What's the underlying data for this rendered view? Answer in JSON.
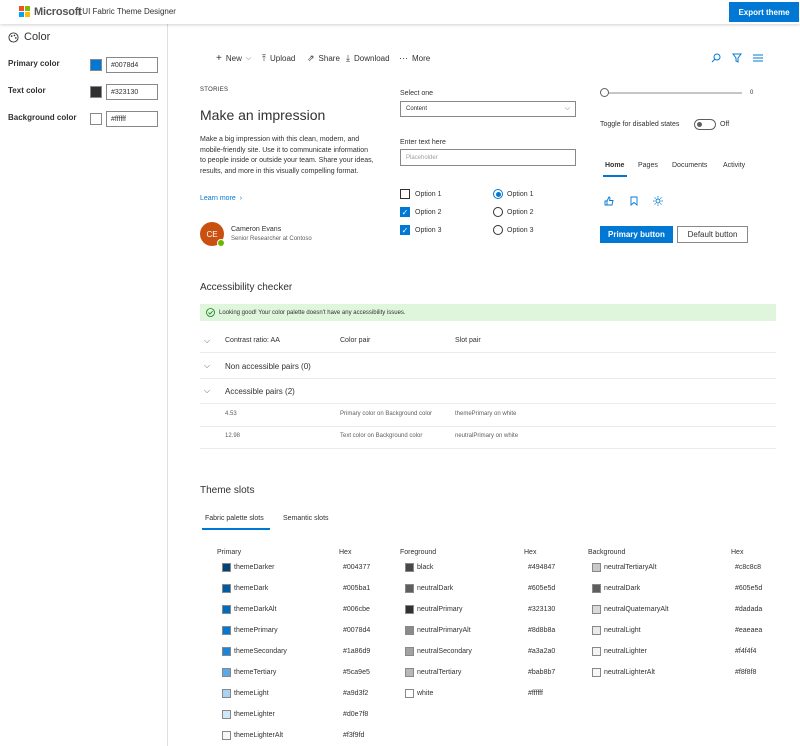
{
  "header": {
    "brand": "Microsoft",
    "app_title": "| UI Fabric Theme Designer",
    "export_label": "Export theme"
  },
  "sidebar": {
    "title": "Color",
    "rows": [
      {
        "label": "Primary color",
        "hex": "#0078d4",
        "swatch": "#0078d4"
      },
      {
        "label": "Text color",
        "hex": "#323130",
        "swatch": "#323130"
      },
      {
        "label": "Background color",
        "hex": "#ffffff",
        "swatch": "#ffffff"
      }
    ]
  },
  "commandbar": {
    "new": "New",
    "upload": "Upload",
    "share": "Share",
    "download": "Download",
    "more": "More"
  },
  "story": {
    "eyebrow": "STORIES",
    "title": "Make an impression",
    "body": "Make a big impression with this clean, modern, and mobile-friendly site. Use it to communicate information to people inside or outside your team. Share your ideas, results, and more in this visually compelling format.",
    "link": "Learn more",
    "persona_initials": "CE",
    "persona_name": "Cameron Evans",
    "persona_role": "Senior Researcher at Contoso"
  },
  "form": {
    "dropdown_label": "Select one",
    "dropdown_value": "Content",
    "text_label": "Enter text here",
    "text_placeholder": "Placeholder",
    "checkboxes": [
      {
        "label": "Option 1",
        "checked": false
      },
      {
        "label": "Option 2",
        "checked": true
      },
      {
        "label": "Option 3",
        "checked": true
      }
    ],
    "radios": [
      {
        "label": "Option 1",
        "checked": true
      },
      {
        "label": "Option 2",
        "checked": false
      },
      {
        "label": "Option 3",
        "checked": false
      }
    ]
  },
  "controls": {
    "slider_value": "0",
    "toggle_label": "Toggle for disabled states",
    "toggle_state": "Off",
    "tabs": [
      "Home",
      "Pages",
      "Documents",
      "Activity"
    ],
    "primary_button": "Primary button",
    "default_button": "Default button"
  },
  "accessibility": {
    "title": "Accessibility checker",
    "banner": "Looking good! Your color palette doesn't have any accessibility issues.",
    "columns": [
      "Contrast ratio: AA",
      "Color pair",
      "Slot pair"
    ],
    "group_non": "Non accessible pairs (0)",
    "group_acc": "Accessible pairs (2)",
    "rows": [
      {
        "ratio": "4.53",
        "pair": "Primary color on Background color",
        "slot": "themePrimary on white"
      },
      {
        "ratio": "12.98",
        "pair": "Text color on Background color",
        "slot": "neutralPrimary on white"
      }
    ]
  },
  "slots": {
    "title": "Theme slots",
    "tabs": [
      "Fabric palette slots",
      "Semantic slots"
    ],
    "primary_head": "Primary",
    "foreground_head": "Foreground",
    "background_head": "Background",
    "hex_head": "Hex",
    "primary": [
      {
        "name": "themeDarker",
        "hex": "#004377"
      },
      {
        "name": "themeDark",
        "hex": "#005ba1"
      },
      {
        "name": "themeDarkAlt",
        "hex": "#006cbe"
      },
      {
        "name": "themePrimary",
        "hex": "#0078d4"
      },
      {
        "name": "themeSecondary",
        "hex": "#1a86d9"
      },
      {
        "name": "themeTertiary",
        "hex": "#5ca9e5"
      },
      {
        "name": "themeLight",
        "hex": "#a9d3f2"
      },
      {
        "name": "themeLighter",
        "hex": "#d0e7f8"
      },
      {
        "name": "themeLighterAlt",
        "hex": "#f3f9fd"
      }
    ],
    "foreground": [
      {
        "name": "black",
        "hex": "#494847"
      },
      {
        "name": "neutralDark",
        "hex": "#605e5d"
      },
      {
        "name": "neutralPrimary",
        "hex": "#323130"
      },
      {
        "name": "neutralPrimaryAlt",
        "hex": "#8d8b8a"
      },
      {
        "name": "neutralSecondary",
        "hex": "#a3a2a0"
      },
      {
        "name": "neutralTertiary",
        "hex": "#bab8b7"
      },
      {
        "name": "white",
        "hex": "#ffffff"
      }
    ],
    "background": [
      {
        "name": "neutralTertiaryAlt",
        "hex": "#c8c8c8"
      },
      {
        "name": "neutralDark",
        "hex": "#605e5d"
      },
      {
        "name": "neutralQuaternaryAlt",
        "hex": "#dadada"
      },
      {
        "name": "neutralLight",
        "hex": "#eaeaea"
      },
      {
        "name": "neutralLighter",
        "hex": "#f4f4f4"
      },
      {
        "name": "neutralLighterAlt",
        "hex": "#f8f8f8"
      }
    ]
  },
  "colors": {
    "accent": "#0078d4",
    "success_bg": "#dff6dd",
    "persona_bg": "#ca5010",
    "presence": "#6bb700"
  }
}
